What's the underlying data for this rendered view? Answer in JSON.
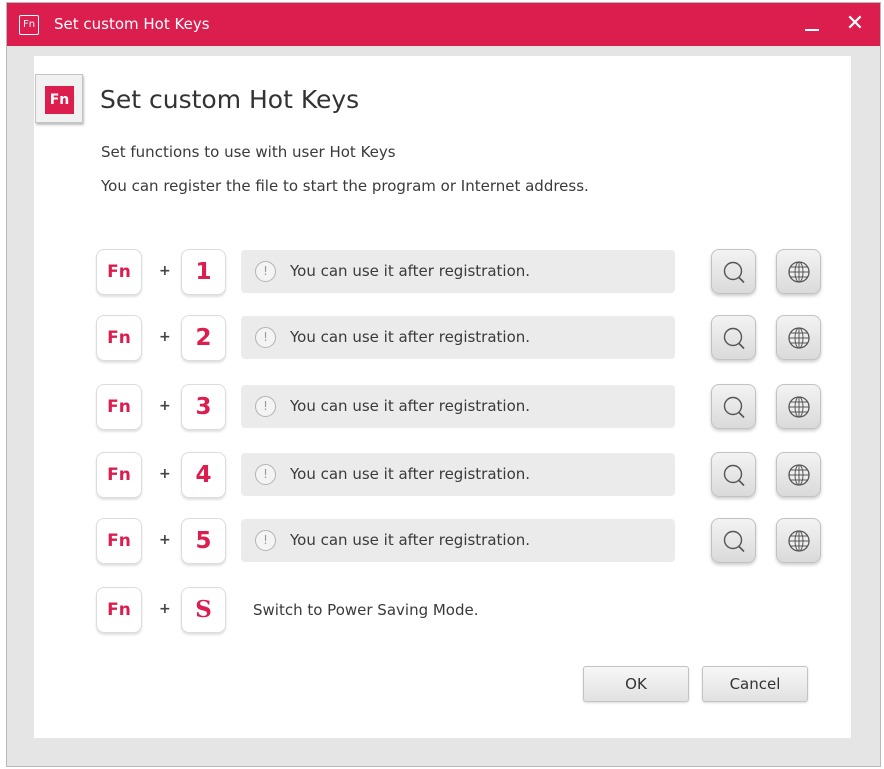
{
  "window": {
    "title": "Set custom Hot Keys",
    "logo_text": "Fn",
    "minimize_icon": "minimize-icon",
    "close_glyph": "✕"
  },
  "colors": {
    "brand": "#dc1e4f",
    "panel_bg": "#ffffff",
    "window_bg": "#e5e5e5",
    "field_bg": "#ebebeb"
  },
  "header": {
    "icon_text": "Fn",
    "title": "Set custom Hot Keys",
    "description_1": "Set functions to use with user Hot Keys",
    "description_2": "You can register the file to start the program or Internet address."
  },
  "hotkeys": [
    {
      "modifier": "Fn",
      "plus": "+",
      "key": "1",
      "status": "You can use it after registration.",
      "warning_glyph": "!",
      "browse_icon": "search-icon",
      "web_icon": "globe-icon"
    },
    {
      "modifier": "Fn",
      "plus": "+",
      "key": "2",
      "status": "You can use it after registration.",
      "warning_glyph": "!",
      "browse_icon": "search-icon",
      "web_icon": "globe-icon"
    },
    {
      "modifier": "Fn",
      "plus": "+",
      "key": "3",
      "status": "You can use it after registration.",
      "warning_glyph": "!",
      "browse_icon": "search-icon",
      "web_icon": "globe-icon"
    },
    {
      "modifier": "Fn",
      "plus": "+",
      "key": "4",
      "status": "You can use it after registration.",
      "warning_glyph": "!",
      "browse_icon": "search-icon",
      "web_icon": "globe-icon"
    },
    {
      "modifier": "Fn",
      "plus": "+",
      "key": "5",
      "status": "You can use it after registration.",
      "warning_glyph": "!",
      "browse_icon": "search-icon",
      "web_icon": "globe-icon"
    }
  ],
  "power_saving": {
    "modifier": "Fn",
    "plus": "+",
    "key": "S",
    "description": "Switch to Power Saving Mode."
  },
  "buttons": {
    "ok": "OK",
    "cancel": "Cancel"
  }
}
